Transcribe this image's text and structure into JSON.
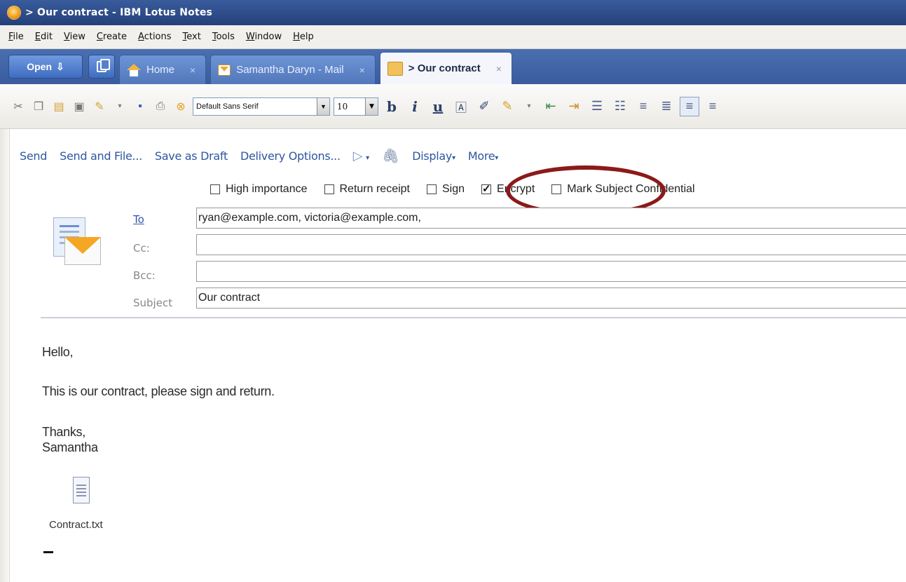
{
  "window": {
    "title": "> Our contract - IBM Lotus Notes"
  },
  "menu": [
    "File",
    "Edit",
    "View",
    "Create",
    "Actions",
    "Text",
    "Tools",
    "Window",
    "Help"
  ],
  "tabs": {
    "open_label": "Open",
    "items": [
      {
        "label": "Home",
        "icon": "home-icon",
        "close": "×"
      },
      {
        "label": "Samantha Daryn - Mail",
        "icon": "mail-icon",
        "close": "×"
      },
      {
        "label": "> Our contract",
        "icon": "document-icon",
        "close": "×"
      }
    ]
  },
  "formatting": {
    "font": "Default Sans Serif",
    "size": "10",
    "bold": "b",
    "italic": "i",
    "underline": "u"
  },
  "actions": {
    "send": "Send",
    "send_and_file": "Send and File...",
    "save_draft": "Save as Draft",
    "delivery": "Delivery Options...",
    "display": "Display",
    "more": "More",
    "dropdown_arrow": "▾"
  },
  "options": {
    "high_importance": {
      "label": "High importance",
      "checked": false
    },
    "return_receipt": {
      "label": "Return receipt",
      "checked": false
    },
    "sign": {
      "label": "Sign",
      "checked": false
    },
    "encrypt": {
      "label": "Encrypt",
      "checked": true
    },
    "mark_confidential": {
      "label": "Mark Subject Confidential",
      "checked": false
    }
  },
  "fields": {
    "to_label": "To",
    "to_value": "ryan@example.com, victoria@example.com,",
    "cc_label": "Cc:",
    "cc_value": "",
    "bcc_label": "Bcc:",
    "bcc_value": "",
    "subject_label": "Subject",
    "subject_value": "Our contract"
  },
  "body": {
    "greeting": "Hello,",
    "line1": "This is our contract, please sign and return.",
    "closing": "Thanks,",
    "signature": "Samantha"
  },
  "attachment": {
    "name": "Contract.txt"
  },
  "colors": {
    "title_bar": "#24407a",
    "link_blue": "#2d57a0",
    "highlight_ellipse": "#8b1a1a"
  }
}
